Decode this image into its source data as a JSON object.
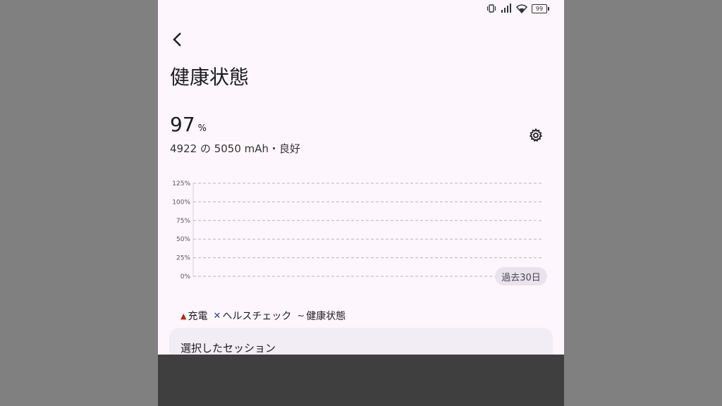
{
  "status_bar": {
    "icons": [
      "vibrate-icon",
      "signal-icon",
      "wifi-icon"
    ],
    "battery_level": "99"
  },
  "header": {
    "title": "健康状態"
  },
  "battery": {
    "percent": "97",
    "percent_unit": "%",
    "capacity_text": "4922 の 5050 mAh・良好"
  },
  "range_chip": {
    "label": "過去30日"
  },
  "legend": [
    {
      "marker": "▲",
      "label": "充電"
    },
    {
      "marker": "✕",
      "label": "ヘルスチェック"
    },
    {
      "marker": "~",
      "label": "健康状態"
    }
  ],
  "session_card": {
    "title": "選択したセッション"
  },
  "colors": {
    "background": "#fdf7fd",
    "charge_marker": "#b3261e",
    "healthcheck_marker": "#2e3c9a",
    "chip_bg": "#e9e3ec"
  },
  "chart_data": {
    "type": "line",
    "y_ticks": [
      "125%",
      "100%",
      "75%",
      "50%",
      "25%",
      "0%"
    ],
    "ylim": [
      0,
      125
    ],
    "grid": true,
    "series": []
  }
}
